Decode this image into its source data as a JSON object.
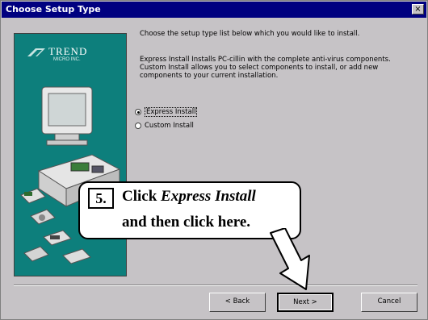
{
  "window": {
    "title": "Choose Setup Type",
    "close_glyph": "×"
  },
  "branding": {
    "logo": "TREND",
    "logo_sub": "MICRO INC."
  },
  "content": {
    "intro": "Choose the setup type list below which you would like to install.",
    "description": "Express Install Installs PC-cillin with the complete anti-virus components. Custom Install allows you to select components to install, or add new components to your current installation.",
    "options": [
      {
        "label": "Express Install",
        "selected": true
      },
      {
        "label": "Custom Install",
        "selected": false
      }
    ]
  },
  "buttons": {
    "back": "< Back",
    "next": "Next >",
    "cancel": "Cancel"
  },
  "callout": {
    "step": "5.",
    "line1_prefix": "Click ",
    "line1_emph": "Express Install",
    "line2": "and then click here."
  },
  "colors": {
    "titlebar": "#000080",
    "panel": "#0d7f7c",
    "dialog": "#c6c3c6"
  }
}
